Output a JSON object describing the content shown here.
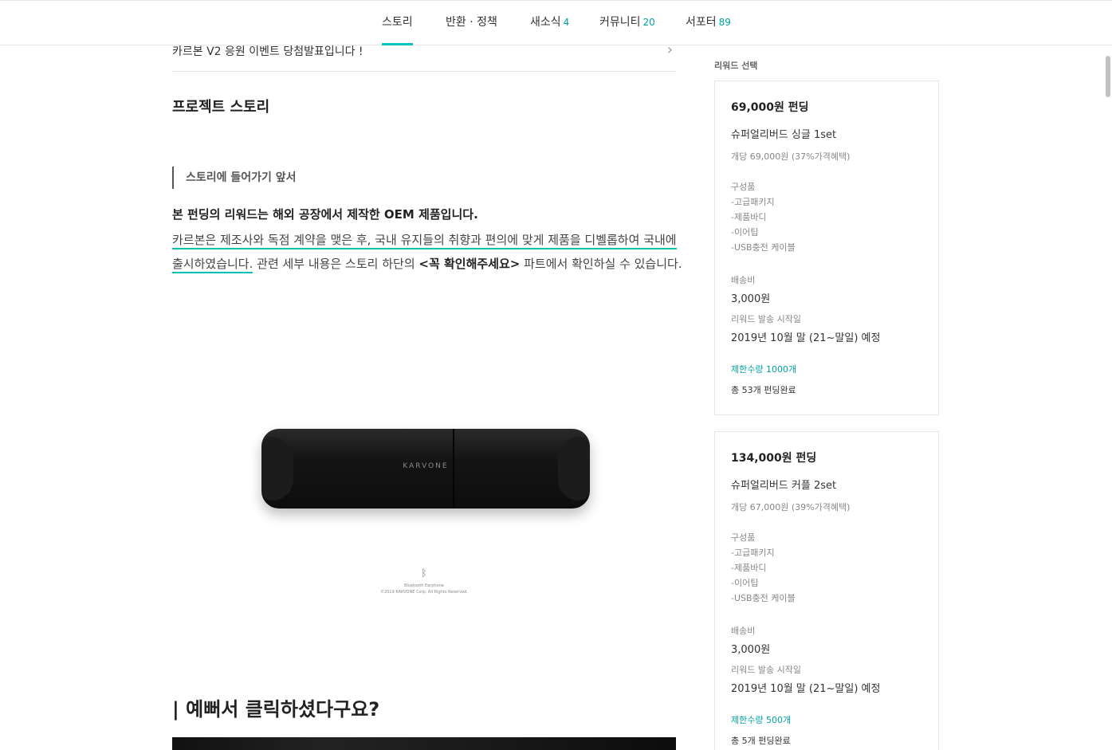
{
  "nav": {
    "tabs": [
      {
        "label": "스토리",
        "count": ""
      },
      {
        "label": "반환 · 정책",
        "count": ""
      },
      {
        "label": "새소식",
        "count": "4"
      },
      {
        "label": "커뮤니티",
        "count": "20"
      },
      {
        "label": "서포터",
        "count": "89"
      }
    ],
    "active_color": "#00c4c4"
  },
  "notice": {
    "text": "카르본 V2 응원 이벤트 당첨발표입니다 !",
    "chevron": "›"
  },
  "story": {
    "title": "프로젝트 스토리",
    "quote": "스토리에 들어가기 앞서",
    "bold_line": "본 펀딩의 리워드는 해외 공장에서 제작한 OEM 제품입니다.",
    "para_part1": "카르본은 제조사와 독점 계약을 맺은 후, 국내 유지들의 취향과 편의에 맞게 제품을 디벨롭하여 국내에 출시하였습니다.",
    "para_part2": " 관련 세부 내용은 스토리 하단의 ",
    "para_part3": "<꼭 확인해주세요>",
    "para_part4": " 파트에서 확인하실 수 있습니다.",
    "image": {
      "brand": "KARVONE",
      "icon": "bluetooth-icon",
      "caption1": "Bluetooth Earphone",
      "caption2": "©2019 KARVONE Corp. All Rights Reserved."
    },
    "headline": "| 예뻐서 클릭하셨다구요?"
  },
  "sidebar": {
    "label": "리워드 선택",
    "rewards": [
      {
        "price": "69,000원 펀딩",
        "name": "슈퍼얼리버드 싱글 1set",
        "unit": "개당 69,000원 (37%가격혜택)",
        "components_label": "구성품",
        "items": [
          "-고급패키지",
          "-제품바디",
          "-이어팁",
          "-USB충전 케이블"
        ],
        "shipping_label": "배송비",
        "shipping": "3,000원",
        "ship_start_label": "리워드 발송 시작일",
        "ship_start": "2019년 10월 말 (21~말일) 예정",
        "limit": "제한수량 1000개",
        "done": "총 53개 펀딩완료"
      },
      {
        "price": "134,000원 펀딩",
        "name": "슈퍼얼리버드 커플 2set",
        "unit": "개당 67,000원 (39%가격혜택)",
        "components_label": "구성품",
        "items": [
          "-고급패키지",
          "-제품바디",
          "-이어팁",
          "-USB충전 케이블"
        ],
        "shipping_label": "배송비",
        "shipping": "3,000원",
        "ship_start_label": "리워드 발송 시작일",
        "ship_start": "2019년 10월 말 (21~말일) 예정",
        "limit": "제한수량 500개",
        "done": "총 5개 펀딩완료"
      }
    ]
  }
}
